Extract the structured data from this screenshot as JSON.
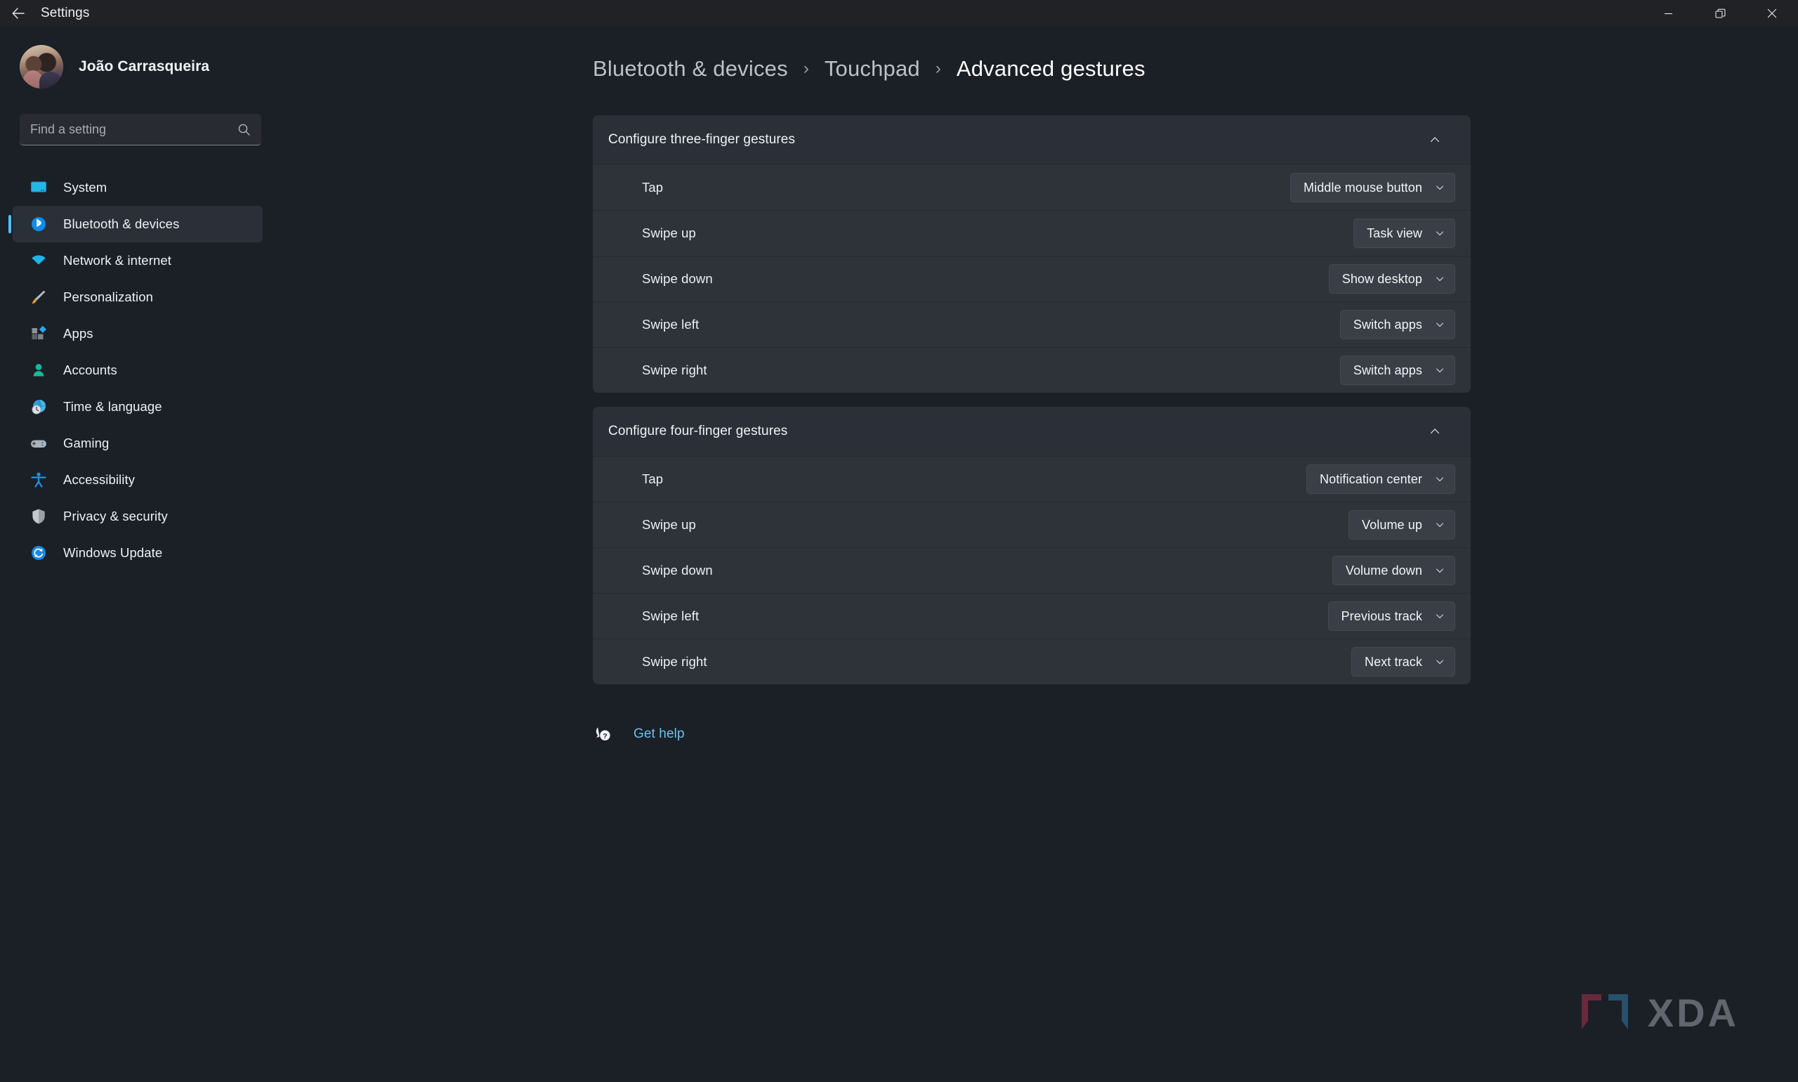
{
  "titlebar": {
    "back_label": "back-arrow",
    "title": "Settings",
    "minimize": "minimize",
    "restore": "restore",
    "close": "close"
  },
  "sidebar": {
    "profile": {
      "name": "João Carrasqueira"
    },
    "search": {
      "placeholder": "Find a setting",
      "value": ""
    },
    "items": [
      {
        "label": "System",
        "icon": "monitor-icon",
        "active": false
      },
      {
        "label": "Bluetooth & devices",
        "icon": "bluetooth-icon",
        "active": true
      },
      {
        "label": "Network & internet",
        "icon": "wifi-icon",
        "active": false
      },
      {
        "label": "Personalization",
        "icon": "paintbrush-icon",
        "active": false
      },
      {
        "label": "Apps",
        "icon": "apps-icon",
        "active": false
      },
      {
        "label": "Accounts",
        "icon": "person-icon",
        "active": false
      },
      {
        "label": "Time & language",
        "icon": "clock-globe-icon",
        "active": false
      },
      {
        "label": "Gaming",
        "icon": "gamepad-icon",
        "active": false
      },
      {
        "label": "Accessibility",
        "icon": "accessibility-icon",
        "active": false
      },
      {
        "label": "Privacy & security",
        "icon": "shield-icon",
        "active": false
      },
      {
        "label": "Windows Update",
        "icon": "update-icon",
        "active": false
      }
    ]
  },
  "breadcrumb": {
    "parent": "Bluetooth & devices",
    "sep1": "›",
    "middle": "Touchpad",
    "sep2": "›",
    "current": "Advanced gestures"
  },
  "cards": [
    {
      "title": "Configure three-finger gestures",
      "collapse_icon": "chevron-up-icon",
      "rows": [
        {
          "label": "Tap",
          "value": "Middle mouse button"
        },
        {
          "label": "Swipe up",
          "value": "Task view"
        },
        {
          "label": "Swipe down",
          "value": "Show desktop"
        },
        {
          "label": "Swipe left",
          "value": "Switch apps"
        },
        {
          "label": "Swipe right",
          "value": "Switch apps"
        }
      ]
    },
    {
      "title": "Configure four-finger gestures",
      "collapse_icon": "chevron-up-icon",
      "rows": [
        {
          "label": "Tap",
          "value": "Notification center"
        },
        {
          "label": "Swipe up",
          "value": "Volume up"
        },
        {
          "label": "Swipe down",
          "value": "Volume down"
        },
        {
          "label": "Swipe left",
          "value": "Previous track"
        },
        {
          "label": "Swipe right",
          "value": "Next track"
        }
      ]
    }
  ],
  "help": {
    "icon": "help-question-icon",
    "label": "Get help"
  },
  "watermark": {
    "text": "XDA",
    "bracket_left_color": "#9b3048",
    "bracket_right_color": "#2f6f96",
    "text_color": "#8d9199"
  },
  "colors": {
    "page_bg": "#1b1f26",
    "titlebar_bg": "#202226",
    "card_header_bg": "#2b2f37",
    "row_bg": "#2e3239",
    "dropdown_bg": "#3a3e46",
    "accent": "#4cc2ff",
    "link": "#70c0e8"
  }
}
